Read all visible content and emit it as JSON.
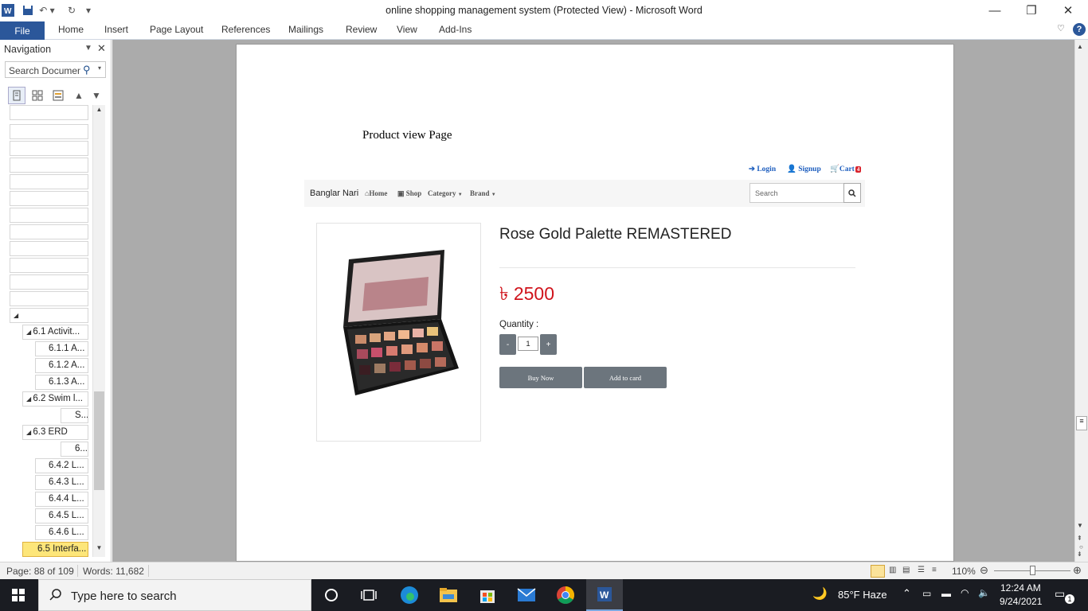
{
  "window": {
    "title": "online shopping management system (Protected View)  -  Microsoft Word"
  },
  "ribbon": {
    "file": "File",
    "tabs": [
      "Home",
      "Insert",
      "Page Layout",
      "References",
      "Mailings",
      "Review",
      "View",
      "Add-Ins"
    ]
  },
  "nav": {
    "header": "Navigation",
    "search_placeholder": "Search Documen",
    "items": [
      "6.1 Activit...",
      "6.1.1 A...",
      "6.1.2 A...",
      "6.1.3 A...",
      "6.2 Swim l...",
      "S...",
      "6.3 ERD",
      "6...",
      "6.4.2 L...",
      "6.4.3 L...",
      "6.4.4 L...",
      "6.4.5 L...",
      "6.4.6 L...",
      "6.5 Interfa..."
    ]
  },
  "doc": {
    "heading": "Product view Page",
    "site": {
      "login": "Login",
      "signup": "Signup",
      "cart": "Cart",
      "cart_count": "4",
      "brand": "Banglar Nari",
      "home": "Home",
      "shop": "Shop",
      "category": "Category",
      "brand_menu": "Brand",
      "search_placeholder": "Search"
    },
    "product": {
      "name": "Rose Gold Palette REMASTERED",
      "price": "৳ 2500",
      "quantity_label": "Quantity :",
      "qty_minus": "-",
      "qty_value": "1",
      "qty_plus": "+",
      "buy_now": "Buy Now",
      "add_to_card": "Add to card"
    }
  },
  "status": {
    "page": "Page: 88 of 109",
    "words": "Words: 11,682",
    "zoom": "110%"
  },
  "taskbar": {
    "search_placeholder": "Type here to search",
    "weather": "85°F  Haze",
    "time": "12:24 AM",
    "date": "9/24/2021",
    "notifications": "1"
  },
  "colors": {
    "word_blue": "#2b579a",
    "price_red": "#d0141c",
    "link_blue": "#1f5fbf",
    "button_gray": "#6c757d",
    "nav_selected": "#fde67a"
  }
}
